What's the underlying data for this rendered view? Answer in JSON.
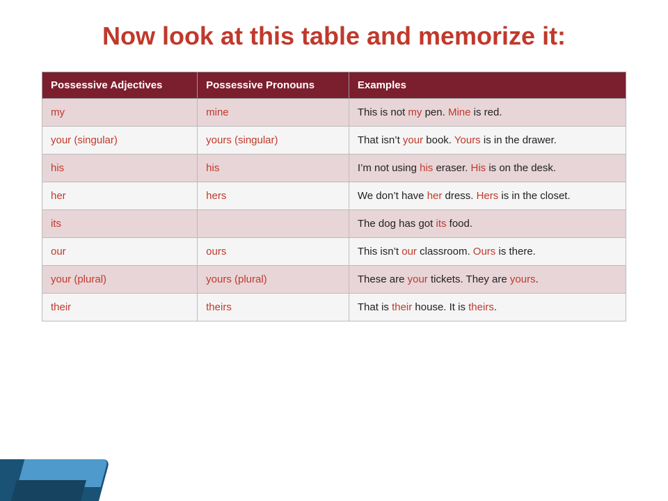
{
  "title": "Now look at this table and memorize it:",
  "table": {
    "headers": [
      "Possessive Adjectives",
      "Possessive Pronouns",
      "Examples"
    ],
    "rows": [
      {
        "adj": "my",
        "pron": "mine",
        "example_parts": [
          {
            "text": "This is not ",
            "style": "normal"
          },
          {
            "text": "my",
            "style": "red"
          },
          {
            "text": " pen. ",
            "style": "normal"
          },
          {
            "text": "Mine",
            "style": "red"
          },
          {
            "text": " is red.",
            "style": "normal"
          }
        ]
      },
      {
        "adj": "your (singular)",
        "pron": "yours (singular)",
        "example_parts": [
          {
            "text": "That isn’t ",
            "style": "normal"
          },
          {
            "text": "your",
            "style": "red"
          },
          {
            "text": " book. ",
            "style": "normal"
          },
          {
            "text": "Yours",
            "style": "red"
          },
          {
            "text": " is in the drawer.",
            "style": "normal"
          }
        ]
      },
      {
        "adj": "his",
        "pron": "his",
        "example_parts": [
          {
            "text": "I’m not using ",
            "style": "normal"
          },
          {
            "text": "his",
            "style": "red"
          },
          {
            "text": " eraser. ",
            "style": "normal"
          },
          {
            "text": "His",
            "style": "red"
          },
          {
            "text": " is on the desk.",
            "style": "normal"
          }
        ]
      },
      {
        "adj": "her",
        "pron": "hers",
        "example_parts": [
          {
            "text": "We don’t have ",
            "style": "normal"
          },
          {
            "text": "her",
            "style": "red"
          },
          {
            "text": " dress. ",
            "style": "normal"
          },
          {
            "text": "Hers",
            "style": "red"
          },
          {
            "text": " is in the closet.",
            "style": "normal"
          }
        ]
      },
      {
        "adj": "its",
        "pron": "",
        "example_parts": [
          {
            "text": "The dog has got ",
            "style": "normal"
          },
          {
            "text": "its",
            "style": "red"
          },
          {
            "text": " food.",
            "style": "normal"
          }
        ]
      },
      {
        "adj": "our",
        "pron": "ours",
        "example_parts": [
          {
            "text": "This isn’t ",
            "style": "normal"
          },
          {
            "text": "our",
            "style": "red"
          },
          {
            "text": " classroom. ",
            "style": "normal"
          },
          {
            "text": "Ours",
            "style": "red"
          },
          {
            "text": " is there.",
            "style": "normal"
          }
        ]
      },
      {
        "adj": "your (plural)",
        "pron": "yours (plural)",
        "example_parts": [
          {
            "text": "These are ",
            "style": "normal"
          },
          {
            "text": "your",
            "style": "red"
          },
          {
            "text": " tickets. They are ",
            "style": "normal"
          },
          {
            "text": "yours",
            "style": "red"
          },
          {
            "text": ".",
            "style": "normal"
          }
        ]
      },
      {
        "adj": "their",
        "pron": "theirs",
        "example_parts": [
          {
            "text": "That is ",
            "style": "normal"
          },
          {
            "text": "their",
            "style": "red"
          },
          {
            "text": " house. It is ",
            "style": "normal"
          },
          {
            "text": "theirs",
            "style": "red"
          },
          {
            "text": ".",
            "style": "normal"
          }
        ]
      }
    ]
  }
}
